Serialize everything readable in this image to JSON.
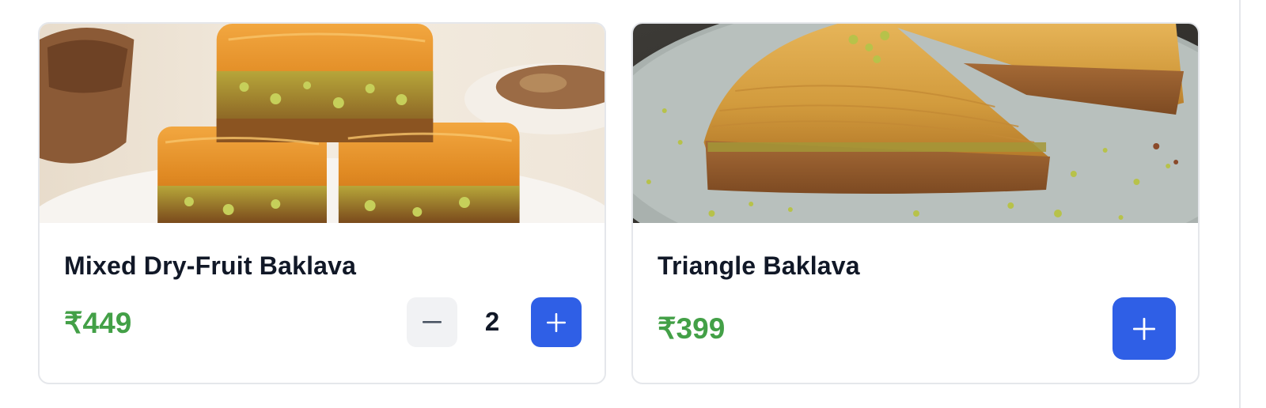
{
  "products": [
    {
      "title": "Mixed Dry-Fruit Baklava",
      "price": "₹449",
      "quantity": "2",
      "image_alt": "Mixed Dry-Fruit Baklava photo"
    },
    {
      "title": "Triangle Baklava",
      "price": "₹399",
      "image_alt": "Triangle Baklava photo"
    }
  ],
  "colors": {
    "price": "#43a047",
    "primary_button": "#2f5fe6",
    "secondary_button": "#f1f2f4",
    "title": "#111827",
    "card_border": "#e5e7eb"
  },
  "icons": {
    "decrement": "minus-icon",
    "increment": "plus-icon",
    "add": "plus-icon"
  }
}
